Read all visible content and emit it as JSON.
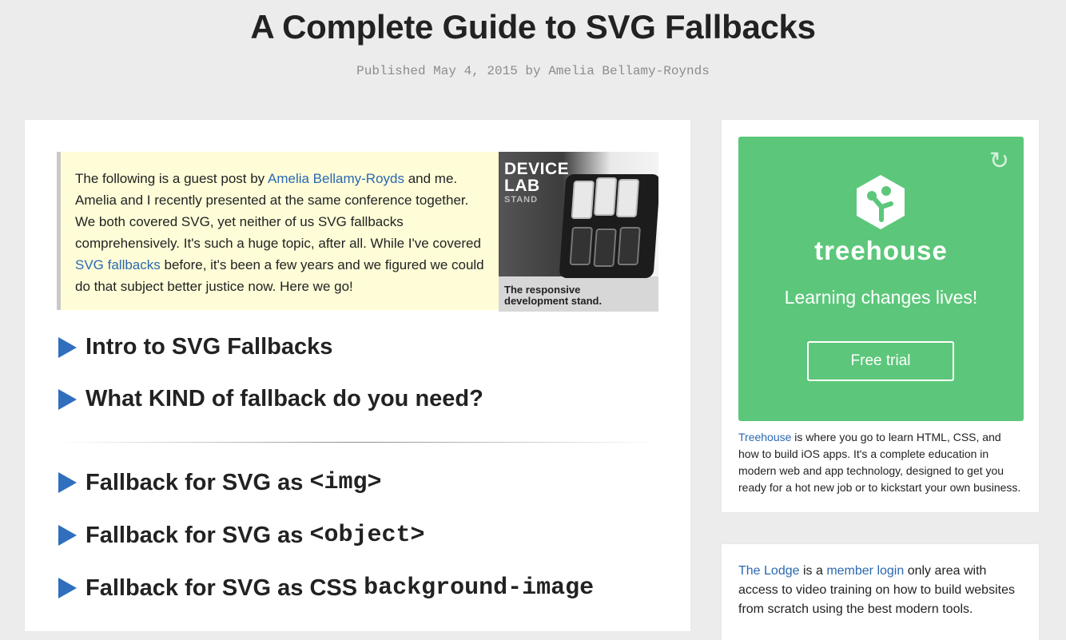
{
  "header": {
    "title": "A Complete Guide to SVG Fallbacks",
    "byline_prefix": "Published May 4, 2015 by ",
    "byline_author": "Amelia Bellamy-Roynds"
  },
  "intro": {
    "part1": "The following is a guest post by ",
    "author_link": "Amelia Bellamy-Royds",
    "part2": " and me. Amelia and I recently presented at the same conference together. We both covered SVG, yet neither of us SVG fallbacks comprehensively. It's such a huge topic, after all. While I've covered ",
    "fallbacks_link": "SVG fallbacks",
    "part3": " before, it's been a few years and we figured we could do that subject better justice now. Here we go!"
  },
  "device_ad": {
    "line1": "DEVICE",
    "line2": "LAB",
    "line3": "STAND",
    "caption1": "The responsive",
    "caption2": "development stand."
  },
  "sections": [
    {
      "text": "Intro to SVG Fallbacks",
      "code": ""
    },
    {
      "text": "What KIND of fallback do you need?",
      "code": ""
    },
    {
      "text": "Fallback for SVG as ",
      "code": "<img>"
    },
    {
      "text": "Fallback for SVG as ",
      "code": "<object>"
    },
    {
      "text": "Fallback for SVG as CSS ",
      "code": "background-image"
    }
  ],
  "treehouse_ad": {
    "brand": "treehouse",
    "tagline": "Learning changes lives!",
    "button": "Free trial",
    "replay_icon": "replay-icon",
    "accent": "#5cc77a",
    "text_link": "Treehouse",
    "text_rest": " is where you go to learn HTML, CSS, and how to build iOS apps. It's a complete education in modern web and app technology, designed to get you ready for a hot new job or to kickstart your own business."
  },
  "lodge": {
    "link1": "The Lodge",
    "text1": " is a ",
    "link2": "member login",
    "text2": " only area with access to video training on how to build websites from scratch using the best modern tools."
  },
  "colors": {
    "link": "#2a68b2",
    "triangle": "#2f6fbd",
    "quote_bg": "#fefdd8",
    "page_bg": "#ececec"
  }
}
